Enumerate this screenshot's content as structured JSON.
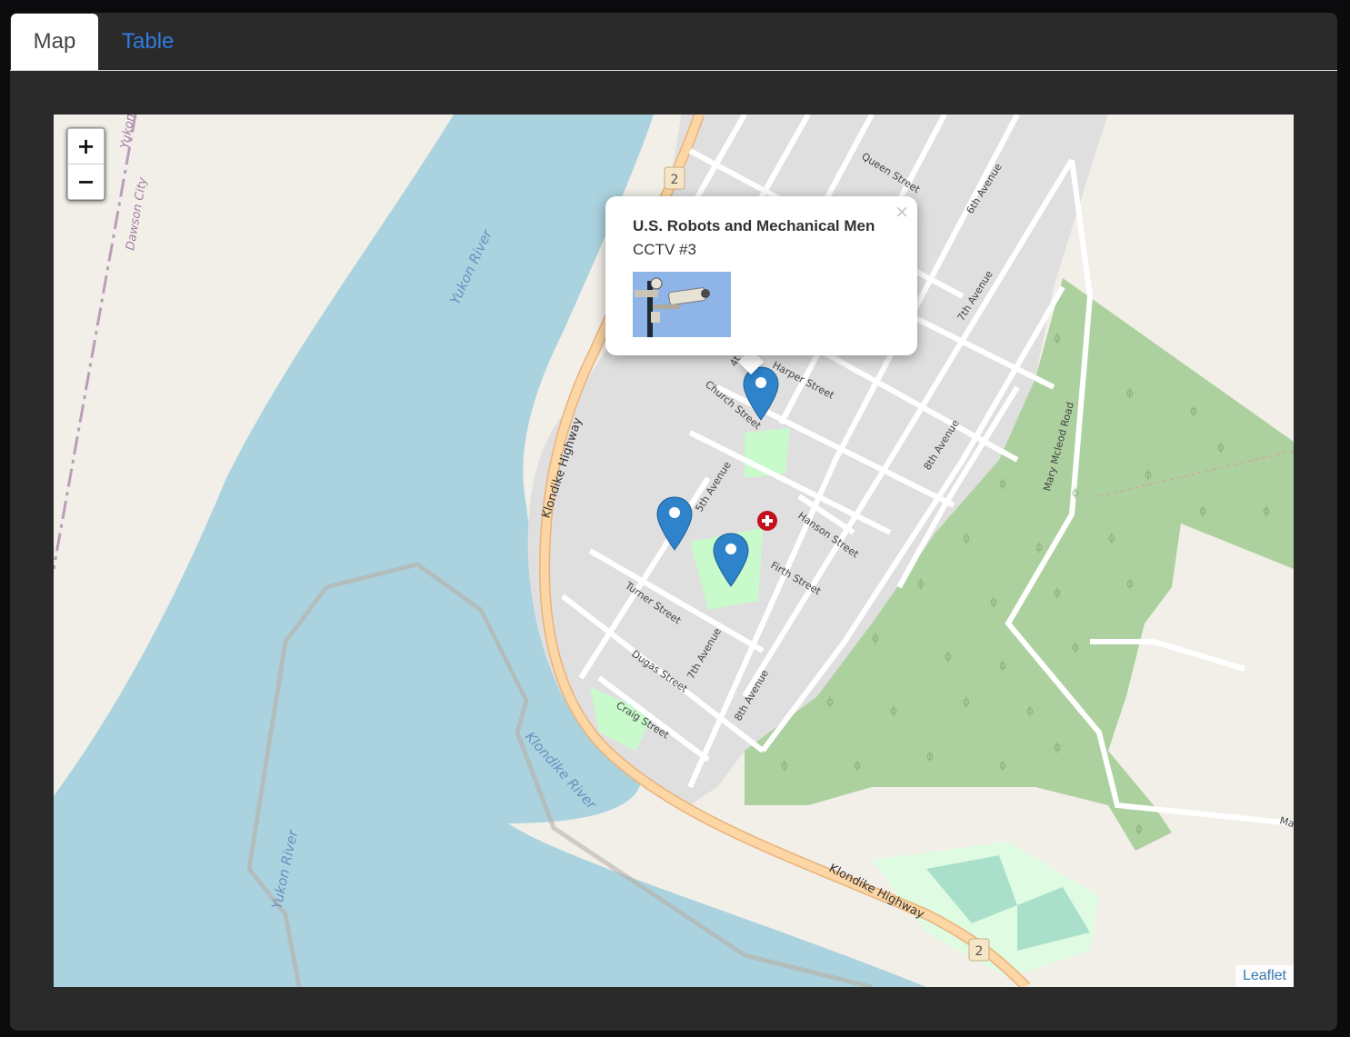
{
  "tabs": [
    {
      "label": "Map",
      "active": true
    },
    {
      "label": "Table",
      "active": false
    }
  ],
  "map": {
    "zoom_in_label": "+",
    "zoom_out_label": "−",
    "attribution": "Leaflet",
    "labels": {
      "yukon_river_1": "Yukon River",
      "yukon_river_2": "Yukon River",
      "klondike_river": "Klondike River",
      "klondike_highway_1": "Klondike Highway",
      "klondike_highway_2": "Klondike Highway",
      "dawson_city": "Dawson City",
      "yukon_edge": "Yukon",
      "queen_street": "Queen Street",
      "sixth_avenue_top": "6th Avenue",
      "seventh_avenue_top": "7th Avenue",
      "eighth_avenue_top": "8th Avenue",
      "church_street": "Church Street",
      "harper_street": "Harper Street",
      "fifth_avenue": "5th Avenue",
      "hanson_street": "Hanson Street",
      "firth_street": "Firth Street",
      "turner_street": "Turner Street",
      "dugas_street": "Dugas Street",
      "seventh_avenue": "7th Avenue",
      "eighth_avenue": "8th Avenue",
      "craig_street": "Craig Street",
      "mary_mcleod_road": "Mary Mcleod Road",
      "edge_road": "Ma",
      "highway_shield_1": "2",
      "highway_shield_2": "2",
      "fourth_avenue_partial": "4t"
    },
    "markers_count": 3
  },
  "popup": {
    "title": "U.S. Robots and Mechanical Men",
    "subtitle": "CCTV #3",
    "close_label": "×"
  },
  "colors": {
    "water": "#aad3df",
    "land": "#f2efe9",
    "town": "#e0dfdf",
    "forest": "#add19e",
    "highway": "#fcd6a4",
    "marker": "#2e83cb",
    "tab_link": "#2f7de1"
  }
}
